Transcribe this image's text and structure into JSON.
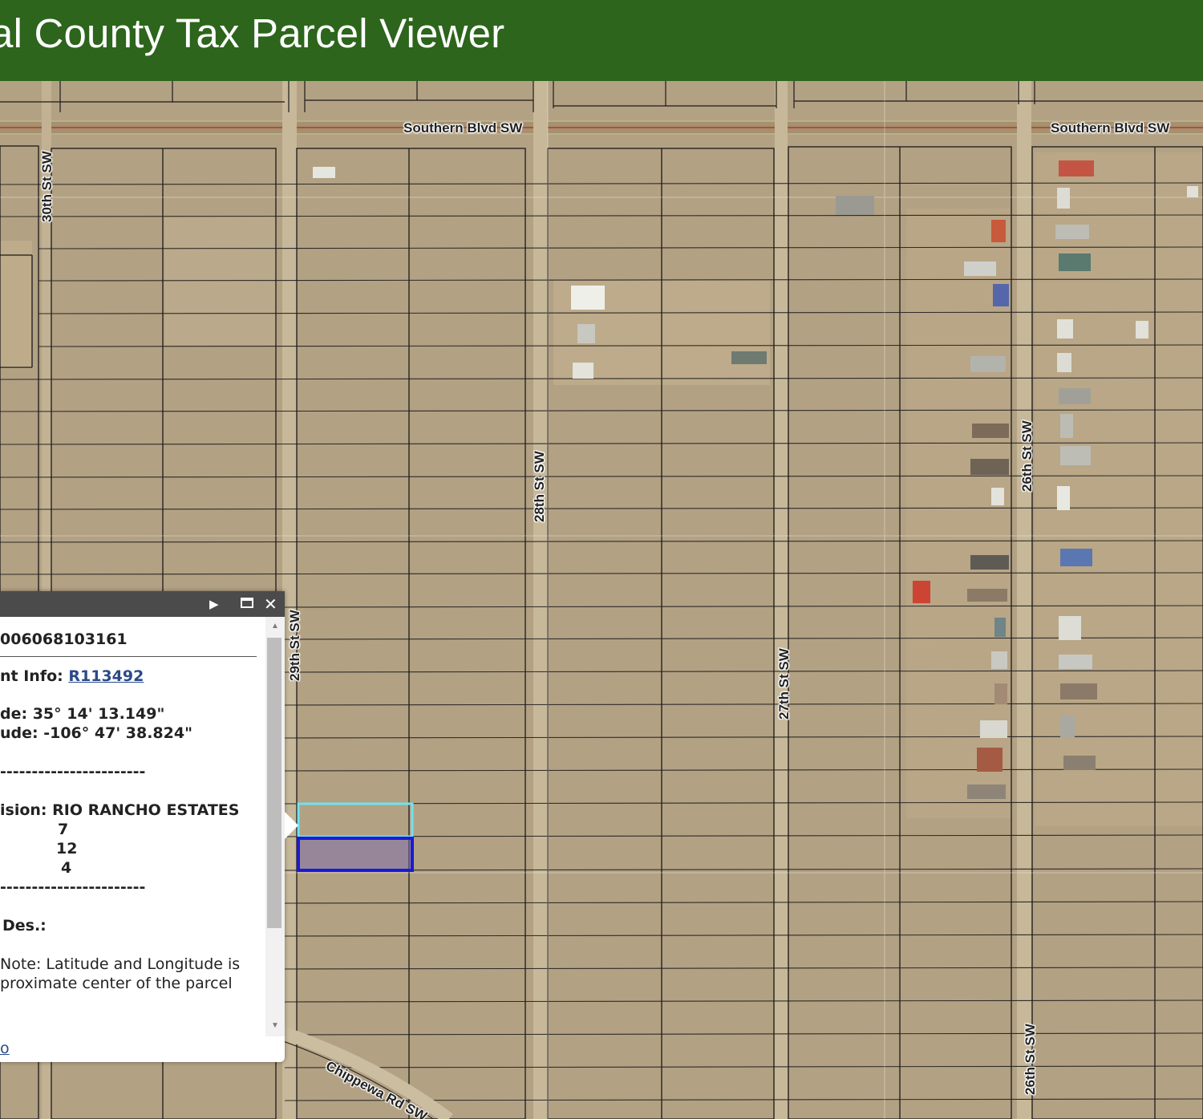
{
  "header": {
    "title": "al County Tax Parcel Viewer"
  },
  "map": {
    "roads": {
      "southern_1": "Southern  Blvd  SW",
      "southern_2": "Southern  Blvd  SW",
      "st30": "30th  St  SW",
      "st29": "29th  St  SW",
      "st28": "28th  St  SW",
      "st27": "27th  St  SW",
      "st26a": "26th  St  SW",
      "st26b": "26th  St  SW",
      "chippewa": "Chippewa  Rd  SW"
    }
  },
  "popup": {
    "controls": {
      "next": "▶",
      "maximize": "▭",
      "close": "✕"
    },
    "parcel_id": "006068103161",
    "account_label": "nt Info:",
    "account_value": "R113492",
    "latitude": "de: 35° 14' 13.149\"",
    "longitude": "ude: -106° 47' 38.824\"",
    "separator": "-----------------------",
    "subdivision": "ision: RIO RANCHO ESTATES",
    "unit": "7",
    "block": "12",
    "lot": "4",
    "legal_label": "Des.:",
    "note_line1": "Note: Latitude and Longitude is",
    "note_line2": "proximate center of the parcel",
    "zoom_link": "o"
  },
  "colors": {
    "header_bg": "#2c651b",
    "popup_bar": "#4b4b4b",
    "selected_parcel": "#1a1ad6",
    "highlight_parcel": "#6fe3f0"
  }
}
